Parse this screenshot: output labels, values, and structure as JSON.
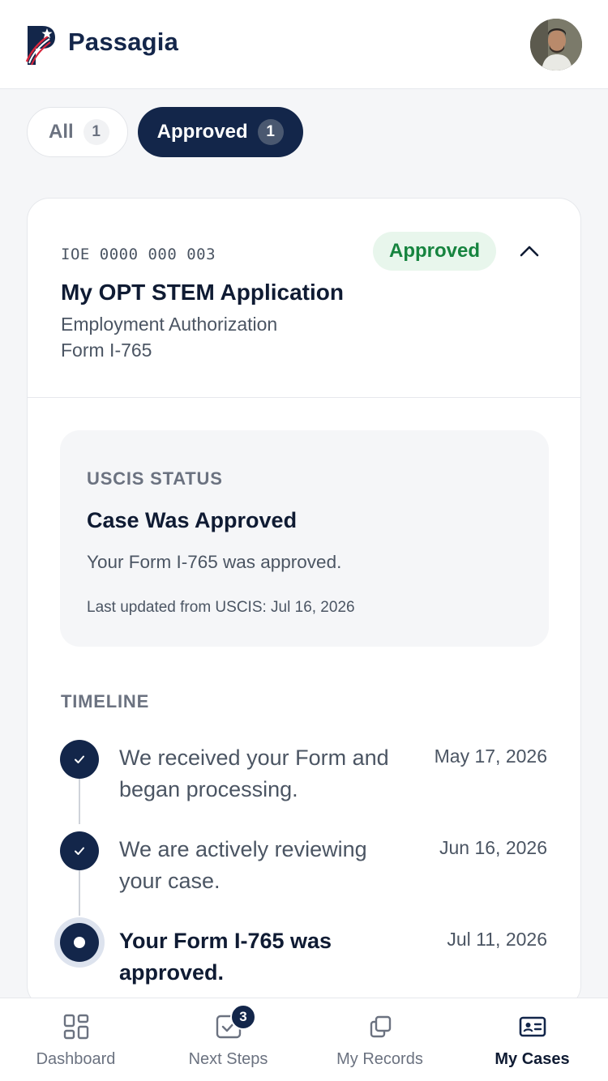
{
  "app": {
    "brand": "Passagia"
  },
  "filters": {
    "all": {
      "label": "All",
      "count": "1"
    },
    "approved": {
      "label": "Approved",
      "count": "1"
    }
  },
  "case": {
    "id": "IOE 0000 000 003",
    "badge": "Approved",
    "title": "My OPT STEM Application",
    "subtitle": "Employment Authorization",
    "form": "Form I-765"
  },
  "uscis": {
    "label": "USCIS STATUS",
    "title": "Case Was Approved",
    "text": "Your Form I-765 was approved.",
    "updated": "Last updated from USCIS: Jul 16, 2026"
  },
  "timeline": {
    "label": "TIMELINE",
    "items": [
      {
        "text": "We received your Form and began processing.",
        "date": "May 17, 2026"
      },
      {
        "text": "We are actively reviewing your case.",
        "date": "Jun 16, 2026"
      },
      {
        "text": "Your Form I-765 was approved.",
        "date": "Jul 11, 2026"
      }
    ]
  },
  "nav": {
    "items": [
      {
        "label": "Dashboard"
      },
      {
        "label": "Next Steps",
        "badge": "3"
      },
      {
        "label": "My Records"
      },
      {
        "label": "My Cases"
      }
    ]
  },
  "colors": {
    "primary": "#13264a",
    "success": "#16843f",
    "success_bg": "#e8f6ec"
  }
}
